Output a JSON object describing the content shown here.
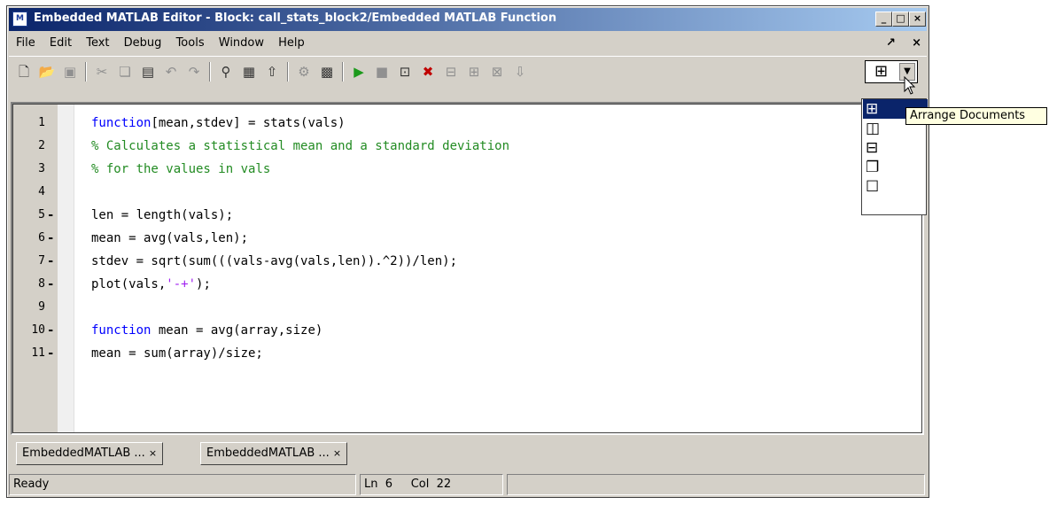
{
  "window": {
    "title": "Embedded MATLAB Editor - Block: call_stats_block2/Embedded MATLAB Function",
    "app_icon": "M",
    "buttons": [
      "_",
      "□",
      "×"
    ]
  },
  "menu": {
    "items": [
      "File",
      "Edit",
      "Text",
      "Debug",
      "Tools",
      "Window",
      "Help"
    ],
    "right": [
      "↗",
      "×"
    ]
  },
  "toolbar": {
    "icons": [
      "new-file-icon",
      "open-folder-icon",
      "save-icon",
      "cut-icon",
      "copy-icon",
      "paste-icon",
      "undo-icon",
      "redo-icon",
      "find-icon",
      "go-to-icon",
      "up-icon",
      "build-icon",
      "simulink-icon",
      "run-icon",
      "stop-icon",
      "set-breakpoint-icon",
      "clear-breakpoints-icon",
      "step-icon",
      "step-in-icon",
      "step-out-icon",
      "exit-debug-icon"
    ],
    "arrange_glyph": "⊞"
  },
  "code": {
    "lines": [
      {
        "num": "1",
        "dash": "",
        "parts": [
          [
            "kw",
            "function"
          ],
          [
            "",
            "[mean,stdev] = stats(vals)"
          ]
        ]
      },
      {
        "num": "2",
        "dash": "",
        "parts": [
          [
            "cm",
            "% Calculates a statistical mean and a standard deviation"
          ]
        ]
      },
      {
        "num": "3",
        "dash": "",
        "parts": [
          [
            "cm",
            "% for the values in vals"
          ]
        ]
      },
      {
        "num": "4",
        "dash": "",
        "parts": []
      },
      {
        "num": "5",
        "dash": "-",
        "parts": [
          [
            "",
            "len = length(vals);"
          ]
        ]
      },
      {
        "num": "6",
        "dash": "-",
        "parts": [
          [
            "",
            "mean = avg(vals,len);"
          ]
        ]
      },
      {
        "num": "7",
        "dash": "-",
        "parts": [
          [
            "",
            "stdev = sqrt(sum(((vals-avg(vals,len)).^2))/len);"
          ]
        ]
      },
      {
        "num": "8",
        "dash": "-",
        "parts": [
          [
            "",
            "plot(vals,"
          ],
          [
            "str",
            "'-+'"
          ],
          [
            "",
            ");"
          ]
        ]
      },
      {
        "num": "9",
        "dash": "",
        "parts": []
      },
      {
        "num": "10",
        "dash": "-",
        "parts": [
          [
            "kw",
            "function"
          ],
          [
            "",
            " mean = avg(array,size)"
          ]
        ]
      },
      {
        "num": "11",
        "dash": "-",
        "parts": [
          [
            "",
            "mean = sum(array)/size;"
          ]
        ]
      }
    ]
  },
  "tabs": [
    {
      "label": "EmbeddedMATLAB ...",
      "close": "×"
    },
    {
      "label": "EmbeddedMATLAB ...",
      "close": "×"
    }
  ],
  "status": {
    "text": "Ready",
    "ln_label": "Ln",
    "ln_value": "6",
    "col_label": "Col",
    "col_value": "22"
  },
  "arrange_menu": {
    "items": [
      {
        "name": "tile-icon",
        "glyph": "⊞",
        "selected": true
      },
      {
        "name": "left-right-split-icon",
        "glyph": "◫",
        "selected": false
      },
      {
        "name": "top-bottom-split-icon",
        "glyph": "⊟",
        "selected": false
      },
      {
        "name": "cascade-icon",
        "glyph": "❐",
        "selected": false
      },
      {
        "name": "single-document-icon",
        "glyph": "☐",
        "selected": false
      }
    ],
    "tooltip": "Arrange Documents"
  }
}
